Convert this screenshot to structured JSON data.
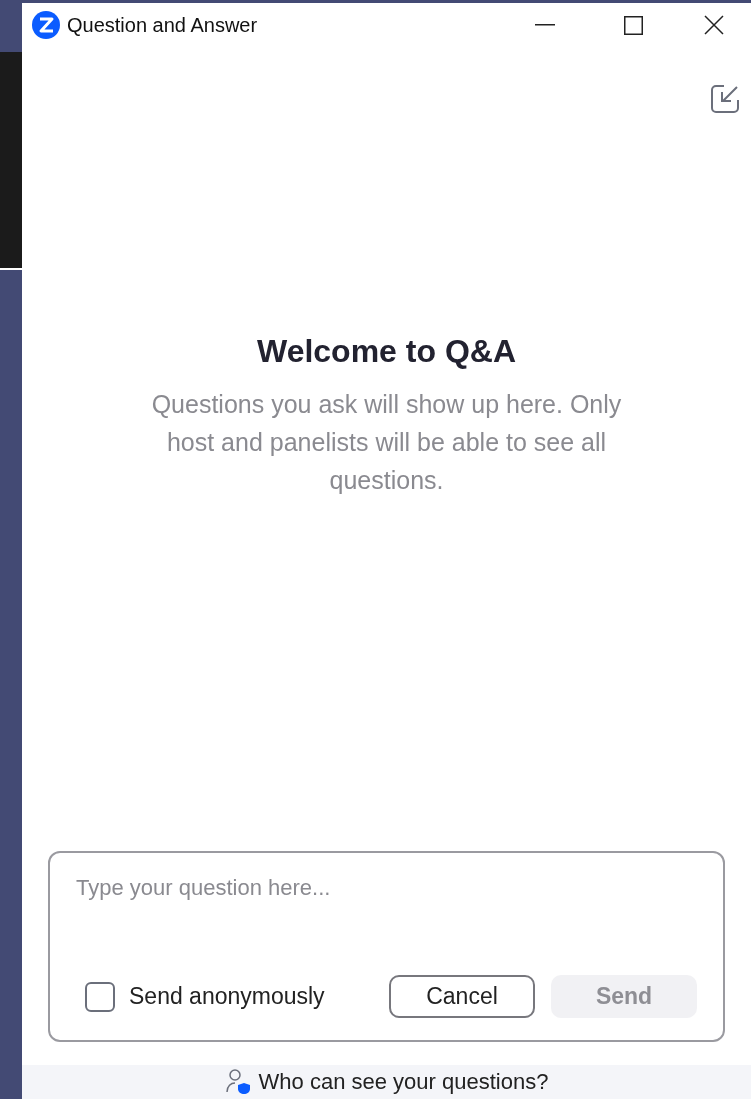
{
  "window": {
    "title": "Question and Answer"
  },
  "welcome": {
    "title": "Welcome to Q&A",
    "message": "Questions you ask will show up here. Only host and panelists will be able to see all questions."
  },
  "question_input": {
    "placeholder": "Type your question here..."
  },
  "anonymous": {
    "label": "Send anonymously",
    "checked": false
  },
  "buttons": [
    {
      "kind": "cancel",
      "label": "Cancel",
      "disabled": false
    },
    {
      "kind": "send",
      "label": "Send",
      "disabled": true
    }
  ],
  "footer": {
    "link": "Who can see your questions?"
  }
}
